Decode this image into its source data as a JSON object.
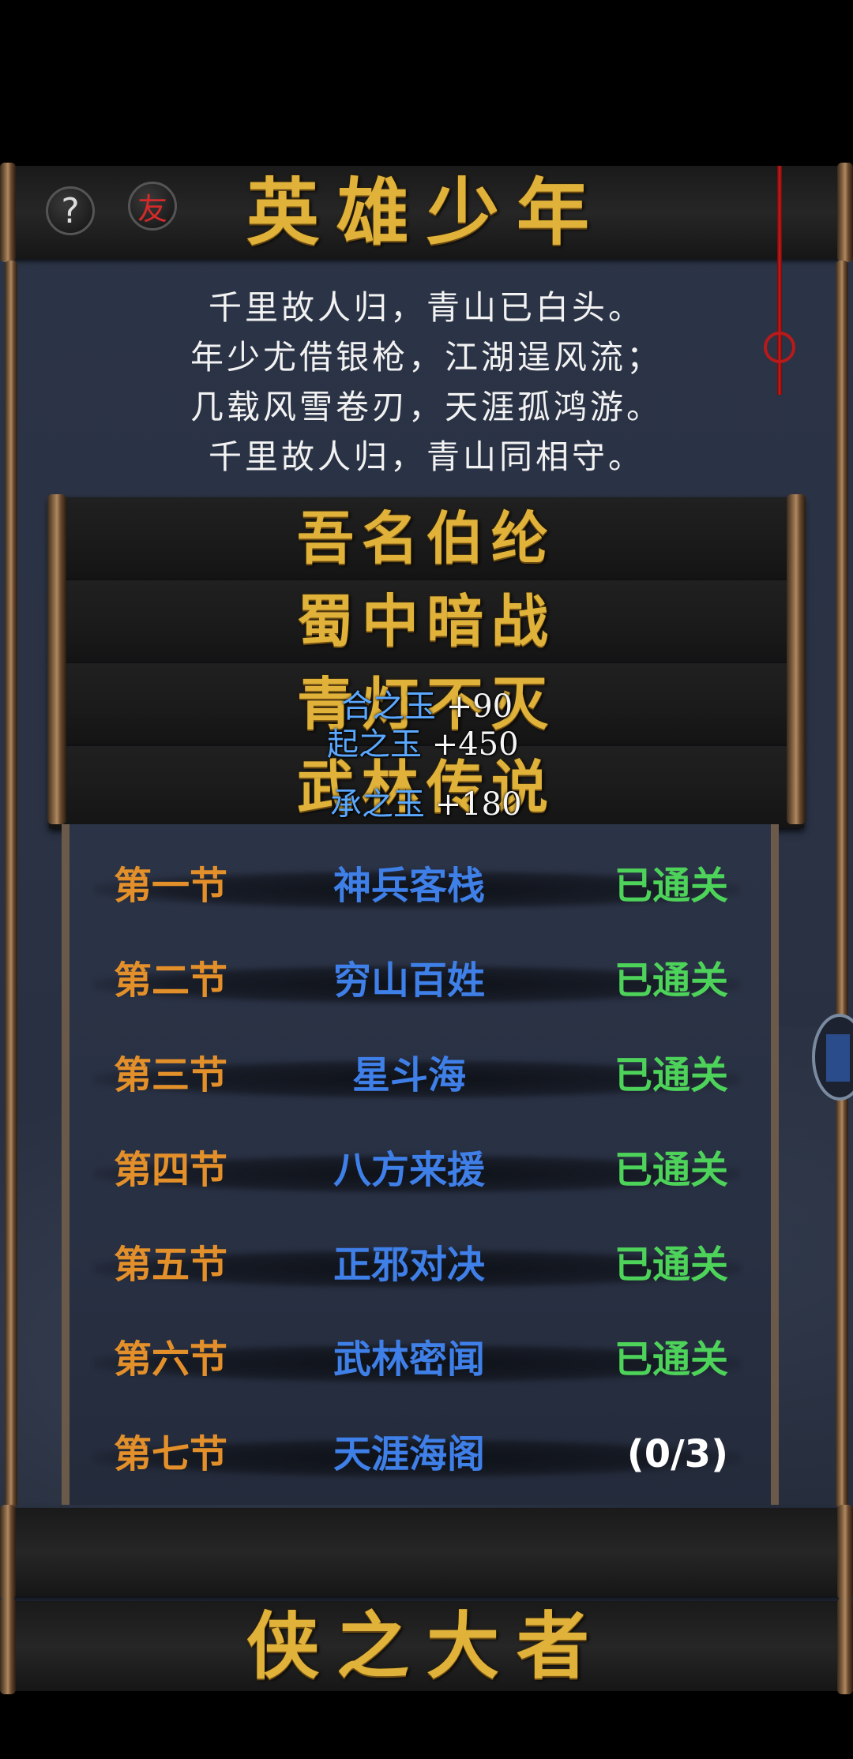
{
  "header": {
    "title": "英雄少年",
    "help_icon": "question-mark-icon",
    "help_glyph": "?",
    "friend_icon": "friend-seal-icon",
    "friend_glyph": "友"
  },
  "poem": [
    "千里故人归，青山已白头。",
    "年少尤借银枪，江湖逞风流；",
    "几载风雪卷刃，天涯孤鸿游。",
    "千里故人归，青山同相守。"
  ],
  "chapters": [
    {
      "title": "吾名伯纶"
    },
    {
      "title": "蜀中暗战"
    },
    {
      "title": "青灯不灭"
    },
    {
      "title": "武林传说"
    }
  ],
  "rewards": [
    {
      "name": "合之玉",
      "amount": "+90"
    },
    {
      "name": "起之玉",
      "amount": "+450"
    },
    {
      "name": "承之玉",
      "amount": "+180"
    }
  ],
  "sections": [
    {
      "section": "第一节",
      "name": "神兵客栈",
      "status": "已通关"
    },
    {
      "section": "第二节",
      "name": "穷山百姓",
      "status": "已通关"
    },
    {
      "section": "第三节",
      "name": "星斗海",
      "status": "已通关"
    },
    {
      "section": "第四节",
      "name": "八方来援",
      "status": "已通关"
    },
    {
      "section": "第五节",
      "name": "正邪对决",
      "status": "已通关"
    },
    {
      "section": "第六节",
      "name": "武林密闻",
      "status": "已通关"
    },
    {
      "section": "第七节",
      "name": "天涯海阁",
      "status": "(0/3)"
    }
  ],
  "footer": {
    "title": "侠之大者"
  },
  "colors": {
    "gold_title": "#e0b23a",
    "section_orange": "#e4902a",
    "name_blue": "#3f7fe8",
    "cleared_green": "#4ed35a",
    "reward_blue": "#5aa8ff",
    "cord_red": "#c81c1c"
  }
}
